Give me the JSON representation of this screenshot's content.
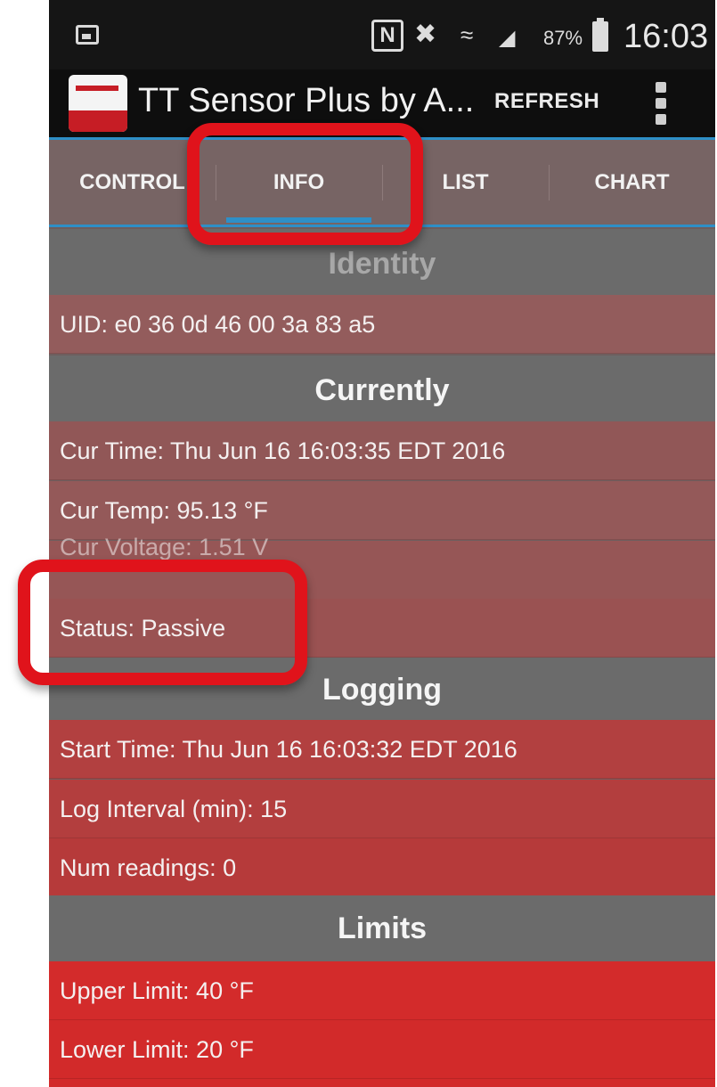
{
  "status_bar": {
    "nfc": "N",
    "mute_icon": "mute-icon",
    "wifi_icon": "wifi-icon",
    "signal_icon": "signal-icon",
    "battery_percent": "87%",
    "time": "16:03"
  },
  "app_bar": {
    "title": "TT Sensor Plus by A...",
    "refresh_label": "REFRESH",
    "menu_icon": "more-vert-icon"
  },
  "tabs": [
    {
      "label": "CONTROL",
      "active": false
    },
    {
      "label": "INFO",
      "active": true
    },
    {
      "label": "LIST",
      "active": false
    },
    {
      "label": "CHART",
      "active": false
    }
  ],
  "identity": {
    "header": "Identity",
    "uid": "UID: e0 36 0d 46 00 3a 83 a5"
  },
  "currently": {
    "header": "Currently",
    "cur_time": "Cur Time: Thu Jun 16 16:03:35 EDT 2016",
    "cur_temp": "Cur Temp: 95.13 °F",
    "cur_voltage": "Cur Voltage: 1.51 V",
    "status": "Status: Passive"
  },
  "logging": {
    "header": "Logging",
    "start_time": "Start Time: Thu Jun 16 16:03:32 EDT 2016",
    "log_interval": "Log Interval (min): 15",
    "num_readings": "Num readings: 0"
  },
  "limits": {
    "header": "Limits",
    "upper_limit": "Upper Limit: 40 °F",
    "lower_limit": "Lower Limit: 20 °F"
  },
  "colors": {
    "accent": "#2e8fc7",
    "annotation": "#e0131b"
  }
}
